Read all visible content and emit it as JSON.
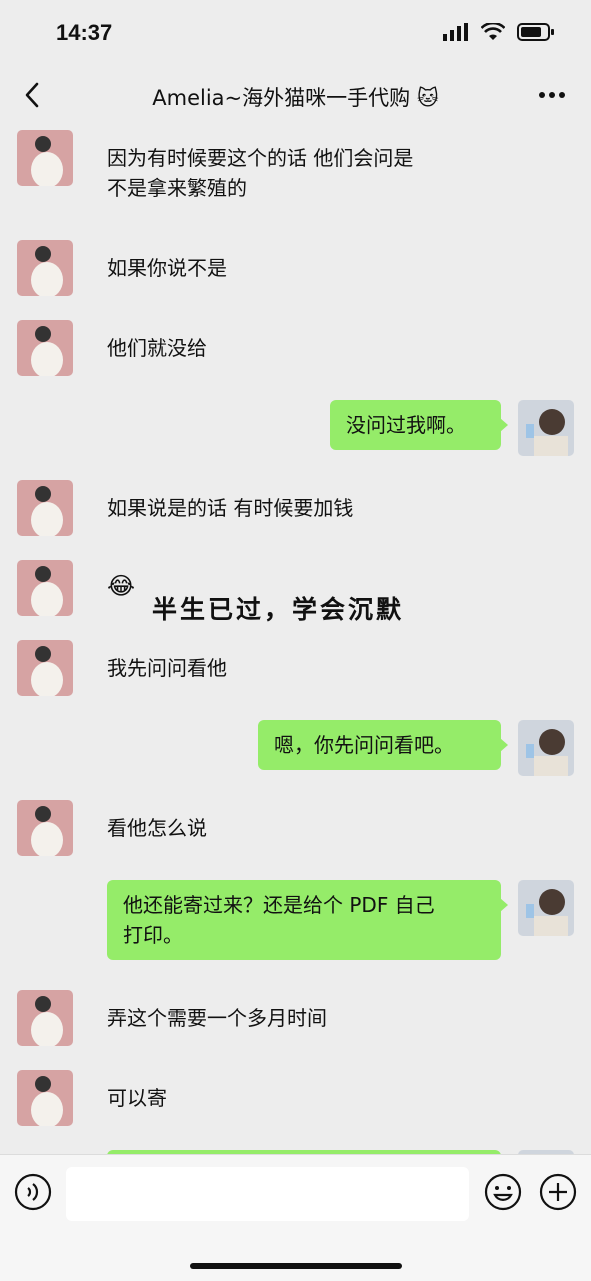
{
  "status_bar": {
    "time": "14:37"
  },
  "header": {
    "title": "Amelia~海外猫咪一手代购 🐱"
  },
  "messages": [
    {
      "from": "other",
      "text": "因为有时候要这个的话 他们会问是"
    },
    {
      "from": "other",
      "text": "不是拿来繁殖的"
    },
    {
      "from": "other",
      "text": "如果你说不是"
    },
    {
      "from": "other",
      "text": "他们就没给"
    },
    {
      "from": "me",
      "text": "没问过我啊。"
    },
    {
      "from": "other",
      "text": "如果说是的话 有时候要加钱"
    },
    {
      "from": "other",
      "sticker_emoji": "😂",
      "sticker_text": "半生已过，学会沉默"
    },
    {
      "from": "other",
      "text": "我先问问看他"
    },
    {
      "from": "me",
      "text": "嗯，你先问问看吧。"
    },
    {
      "from": "other",
      "text": "看他怎么说"
    },
    {
      "from": "me",
      "text": "他还能寄过来？还是给个 PDF 自己"
    },
    {
      "from": "me",
      "text": "打印。"
    },
    {
      "from": "other",
      "text": "弄这个需要一个多月时间"
    },
    {
      "from": "other",
      "text": "可以寄"
    }
  ],
  "icons": {
    "back": "chevron-left-icon",
    "more": "more-dots-icon",
    "voice": "voice-icon",
    "emoji": "emoji-icon",
    "plus": "plus-icon"
  },
  "colors": {
    "bubble_me": "#95ec69",
    "background": "#ededed"
  }
}
